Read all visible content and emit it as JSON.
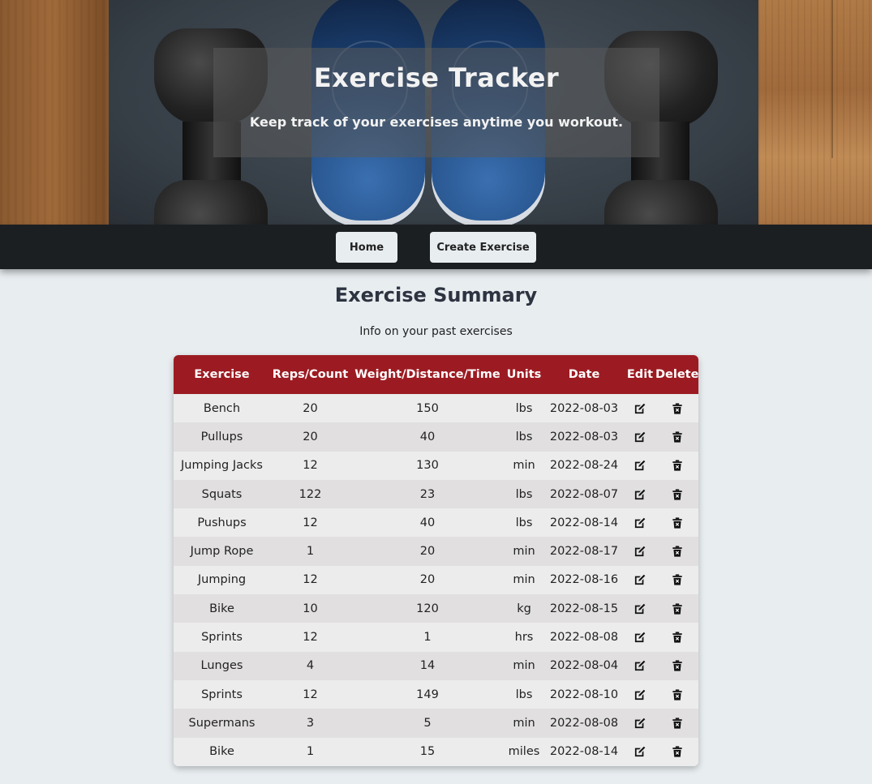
{
  "header": {
    "title": "Exercise Tracker",
    "subtitle": "Keep track of your exercises anytime you workout."
  },
  "nav": {
    "home_label": "Home",
    "create_label": "Create Exercise"
  },
  "main": {
    "title": "Exercise Summary",
    "subtitle": "Info on your past exercises"
  },
  "table": {
    "columns": [
      "Exercise",
      "Reps/Count",
      "Weight/Distance/Time",
      "Units",
      "Date",
      "Edit",
      "Delete"
    ],
    "edit_icon": "edit-icon",
    "delete_icon": "trash-icon",
    "rows": [
      {
        "exercise": "Bench",
        "reps": "20",
        "weight": "150",
        "units": "lbs",
        "date": "2022-08-03"
      },
      {
        "exercise": "Pullups",
        "reps": "20",
        "weight": "40",
        "units": "lbs",
        "date": "2022-08-03"
      },
      {
        "exercise": "Jumping Jacks",
        "reps": "12",
        "weight": "130",
        "units": "min",
        "date": "2022-08-24"
      },
      {
        "exercise": "Squats",
        "reps": "122",
        "weight": "23",
        "units": "lbs",
        "date": "2022-08-07"
      },
      {
        "exercise": "Pushups",
        "reps": "12",
        "weight": "40",
        "units": "lbs",
        "date": "2022-08-14"
      },
      {
        "exercise": "Jump Rope",
        "reps": "1",
        "weight": "20",
        "units": "min",
        "date": "2022-08-17"
      },
      {
        "exercise": "Jumping",
        "reps": "12",
        "weight": "20",
        "units": "min",
        "date": "2022-08-16"
      },
      {
        "exercise": "Bike",
        "reps": "10",
        "weight": "120",
        "units": "kg",
        "date": "2022-08-15"
      },
      {
        "exercise": "Sprints",
        "reps": "12",
        "weight": "1",
        "units": "hrs",
        "date": "2022-08-08"
      },
      {
        "exercise": "Lunges",
        "reps": "4",
        "weight": "14",
        "units": "min",
        "date": "2022-08-04"
      },
      {
        "exercise": "Sprints",
        "reps": "12",
        "weight": "149",
        "units": "lbs",
        "date": "2022-08-10"
      },
      {
        "exercise": "Supermans",
        "reps": "3",
        "weight": "5",
        "units": "min",
        "date": "2022-08-08"
      },
      {
        "exercise": "Bike",
        "reps": "1",
        "weight": "15",
        "units": "miles",
        "date": "2022-08-14"
      }
    ]
  },
  "colors": {
    "header_row": "#9c1b22",
    "nav_bar": "#1c1f22",
    "page_bg": "#e8edf0"
  }
}
